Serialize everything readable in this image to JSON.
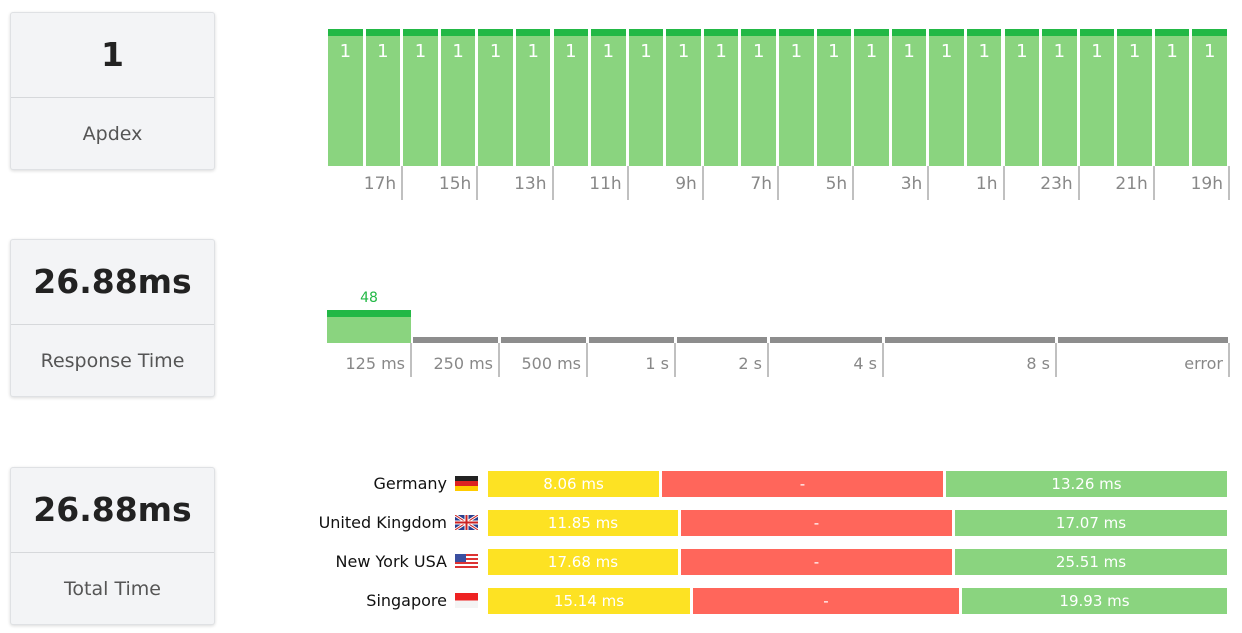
{
  "cards": [
    {
      "value": "1",
      "label": "Apdex"
    },
    {
      "value": "26.88ms",
      "label": "Response Time"
    },
    {
      "value": "26.88ms",
      "label": "Total Time"
    }
  ],
  "apdex_chart": {
    "values": [
      "1",
      "1",
      "1",
      "1",
      "1",
      "1",
      "1",
      "1",
      "1",
      "1",
      "1",
      "1",
      "1",
      "1",
      "1",
      "1",
      "1",
      "1",
      "1",
      "1",
      "1",
      "1",
      "1",
      "1"
    ],
    "labels": [
      "17h",
      "15h",
      "13h",
      "11h",
      "9h",
      "7h",
      "5h",
      "3h",
      "1h",
      "23h",
      "21h",
      "19h"
    ]
  },
  "response_chart": {
    "bins": [
      "125 ms",
      "250 ms",
      "500 ms",
      "1 s",
      "2 s",
      "4 s",
      "8 s",
      "error"
    ],
    "counts": [
      48,
      0,
      0,
      0,
      0,
      0,
      0,
      0
    ],
    "count_label": "48"
  },
  "locations": [
    {
      "name": "Germany",
      "flag": "germany-flag",
      "yellow": "8.06 ms",
      "red": "-",
      "green": "13.26 ms"
    },
    {
      "name": "United Kingdom",
      "flag": "uk-flag",
      "yellow": "11.85 ms",
      "red": "-",
      "green": "17.07 ms"
    },
    {
      "name": "New York USA",
      "flag": "usa-flag",
      "yellow": "17.68 ms",
      "red": "-",
      "green": "25.51 ms"
    },
    {
      "name": "Singapore",
      "flag": "singapore-flag",
      "yellow": "15.14 ms",
      "red": "-",
      "green": "19.93 ms"
    }
  ],
  "colors": {
    "green": "#8ad47f",
    "green_top": "#22b845",
    "yellow": "#fde223",
    "red": "#ff665b"
  }
}
